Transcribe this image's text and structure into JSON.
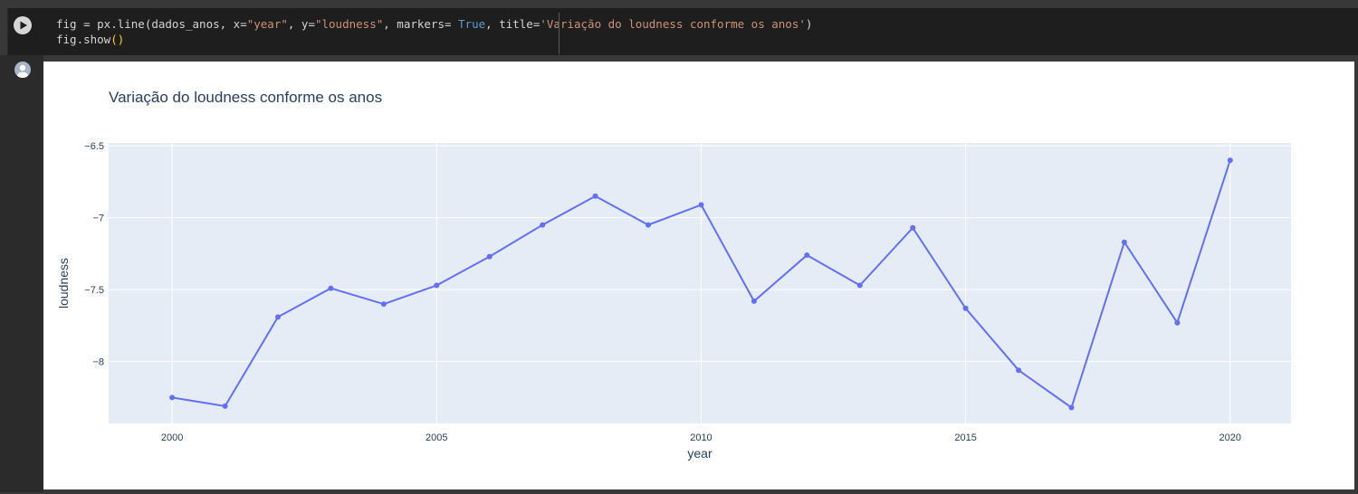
{
  "code": {
    "line1": {
      "p1": "fig = px.line(dados_anos, x=",
      "s1": "\"year\"",
      "p2": ", y=",
      "s2": "\"loudness\"",
      "p3": ", markers= ",
      "kw": "True",
      "p4": ", title=",
      "s3": "'Variação do loudness conforme os anos'",
      "p5": ")"
    },
    "line2": {
      "p1": "fig.show",
      "paren": "()"
    }
  },
  "colors": {
    "line": "#636efa",
    "plot_bg": "#e5ecf6",
    "grid": "#ffffff",
    "text": "#2a3f5f"
  },
  "chart_data": {
    "type": "line",
    "title": "Variação do loudness conforme os anos",
    "xlabel": "year",
    "ylabel": "loudness",
    "x": [
      2000,
      2001,
      2002,
      2003,
      2004,
      2005,
      2006,
      2007,
      2008,
      2009,
      2010,
      2011,
      2012,
      2013,
      2014,
      2015,
      2016,
      2017,
      2018,
      2019,
      2020
    ],
    "y": [
      -8.25,
      -8.31,
      -7.69,
      -7.49,
      -7.6,
      -7.47,
      -7.27,
      -7.05,
      -6.85,
      -7.05,
      -6.91,
      -7.58,
      -7.26,
      -7.47,
      -7.07,
      -7.63,
      -8.06,
      -8.32,
      -7.17,
      -7.73,
      -6.6
    ],
    "xlim": [
      1998.8,
      2021.15
    ],
    "ylim": [
      -8.43,
      -6.48
    ],
    "x_ticks": [
      2000,
      2005,
      2010,
      2015,
      2020
    ],
    "y_ticks": [
      -8,
      -7.5,
      -7,
      -6.5
    ],
    "y_tick_labels": [
      "−8",
      "−7.5",
      "−7",
      "−6.5"
    ],
    "markers": true,
    "grid": true
  }
}
